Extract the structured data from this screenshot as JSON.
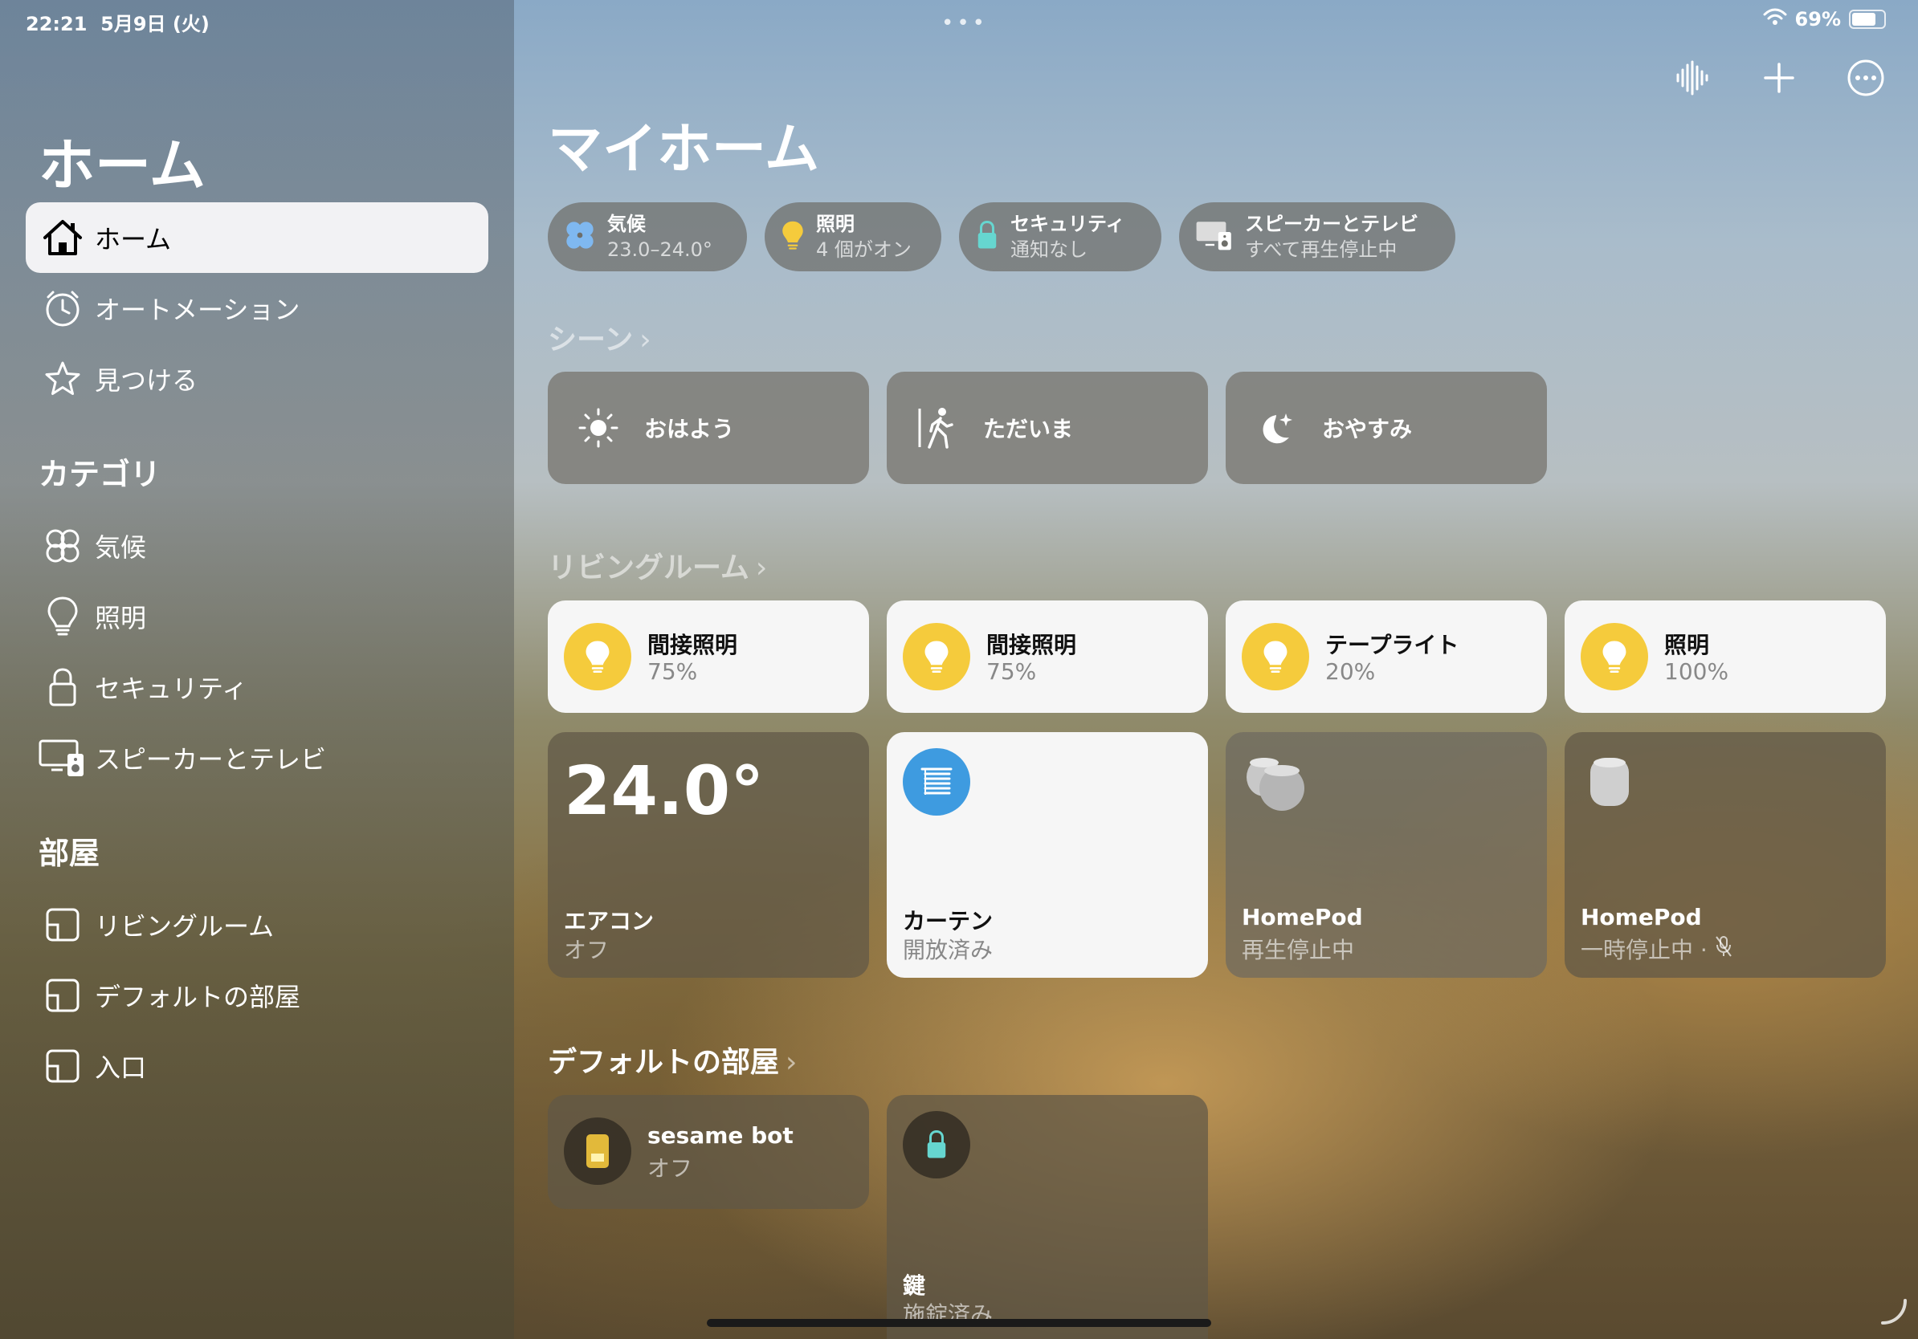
{
  "status": {
    "time": "22:21",
    "date": "5月9日 (火)",
    "battery": "69%",
    "battery_level": 0.69,
    "dots": "•••"
  },
  "sidebar": {
    "title": "ホーム",
    "nav": [
      {
        "label": "ホーム",
        "icon": "house-icon"
      },
      {
        "label": "オートメーション",
        "icon": "clock-icon"
      },
      {
        "label": "見つける",
        "icon": "star-icon"
      }
    ],
    "categories_heading": "カテゴリ",
    "categories": [
      {
        "label": "気候",
        "icon": "fan-icon"
      },
      {
        "label": "照明",
        "icon": "bulb-icon"
      },
      {
        "label": "セキュリティ",
        "icon": "lock-icon"
      },
      {
        "label": "スピーカーとテレビ",
        "icon": "speaker-tv-icon"
      }
    ],
    "rooms_heading": "部屋",
    "rooms": [
      {
        "label": "リビングルーム",
        "icon": "room-icon"
      },
      {
        "label": "デフォルトの部屋",
        "icon": "room-icon"
      },
      {
        "label": "入口",
        "icon": "room-icon"
      }
    ]
  },
  "main": {
    "title": "マイホーム",
    "toolbar": {
      "voice": "waveform-icon",
      "add": "plus-icon",
      "more": "ellipsis-circle-icon"
    },
    "chips": [
      {
        "title": "気候",
        "subtitle": "23.0–24.0°",
        "icon": "fan-icon",
        "color": "#7fb8f0"
      },
      {
        "title": "照明",
        "subtitle": "4 個がオン",
        "icon": "bulb-icon",
        "color": "#f5cb3c"
      },
      {
        "title": "セキュリティ",
        "subtitle": "通知なし",
        "icon": "lock-icon",
        "color": "#66d6d0"
      },
      {
        "title": "スピーカーとテレビ",
        "subtitle": "すべて再生停止中",
        "icon": "speaker-tv-icon",
        "color": "#ffffff"
      }
    ],
    "scenes_heading": "シーン",
    "scenes": [
      {
        "label": "おはよう",
        "icon": "sun-icon"
      },
      {
        "label": "ただいま",
        "icon": "walking-person-icon"
      },
      {
        "label": "おやすみ",
        "icon": "moon-icon"
      }
    ],
    "living_heading": "リビングルーム",
    "lights": [
      {
        "name": "間接照明",
        "value": "75%"
      },
      {
        "name": "間接照明",
        "value": "75%"
      },
      {
        "name": "テープライト",
        "value": "20%"
      },
      {
        "name": "照明",
        "value": "100%"
      }
    ],
    "aircon": {
      "temp": "24.0°",
      "name": "エアコン",
      "status": "オフ"
    },
    "curtain": {
      "name": "カーテン",
      "status": "開放済み"
    },
    "homepod1": {
      "name": "HomePod",
      "status": "再生停止中"
    },
    "homepod2": {
      "name": "HomePod",
      "status": "一時停止中 ·"
    },
    "default_heading": "デフォルトの部屋",
    "sesame": {
      "name": "sesame bot",
      "status": "オフ"
    },
    "lock": {
      "name": "鍵",
      "status": "施錠済み"
    }
  },
  "colors": {
    "accent_bulb": "#f5cb3c",
    "curtain_blue": "#3e9be0",
    "lock_teal": "#66d6d0"
  }
}
